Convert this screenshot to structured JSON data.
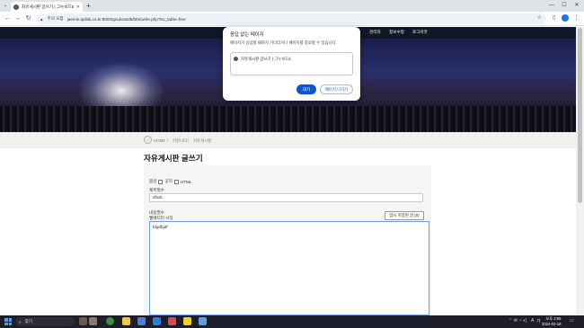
{
  "browser": {
    "tab_title": "자유게시판 글쓰기 | 그누보드5",
    "close_glyph": "✕",
    "new_tab_glyph": "+",
    "security_label": "주의 요함",
    "url": "jaemin.ipdisk.co.kr:8000/gnuboard5/bbs/write.php?bo_table=free",
    "window_controls": [
      "—",
      "☐",
      "✕"
    ]
  },
  "site_nav": {
    "items": [
      "관리자",
      "정보수정",
      "로그아웃"
    ]
  },
  "breadcrumb": {
    "home_glyph": "⌂",
    "items": [
      "HOME",
      "커뮤니티",
      "자유게시판"
    ],
    "separator": "/"
  },
  "page": {
    "title": "자유게시판 글쓰기"
  },
  "form": {
    "options_label": "옵션",
    "notice_label": "공지",
    "html_label": "HTML",
    "subject_label": "제목필수",
    "subject_value": "dfsdc",
    "content_label": "내용필수",
    "editor_label": "웹에디터 시작",
    "temp_save_button": "임시 저장된 글 (0)",
    "content_value": "fdgdfgdf"
  },
  "dialog": {
    "title": "응답 없는 페이지",
    "body": "페이지가 응답할 때까지 기다리거나 페이지를 종료할 수 있습니다.",
    "page_title": "자유게시판 글쓰기 | 그누보드5",
    "wait_button": "대기",
    "exit_button": "페이지 나가기"
  },
  "taskbar": {
    "search_placeholder": "찾기",
    "time": "오후 3:55",
    "date": "2024-02-16",
    "ime": "가",
    "lang": "A",
    "tray_glyphs": "⌃ ✉ ◔ ◖)"
  },
  "colors": {
    "accent": "#0b57d0",
    "nav_bg": "#101828",
    "taskbar_bg": "#1e1e2a"
  }
}
